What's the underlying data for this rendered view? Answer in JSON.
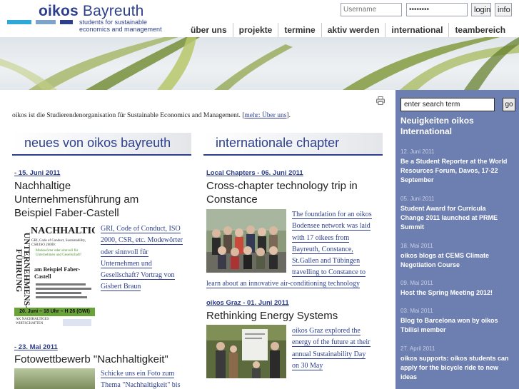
{
  "header": {
    "logo_word_1": "oikos",
    "logo_word_2": "Bayreuth",
    "logo_sub_1": "students for sustainable",
    "logo_sub_2": "economics and management",
    "username_placeholder": "Username",
    "password_value": "••••••••",
    "login_label": "login",
    "info_label": "info",
    "colors": {
      "brand": "#2d3f8c",
      "bar_cyan": "#2fa8d8",
      "bar_blue": "#7ea3c9",
      "bar_dark": "#2d3f8c"
    }
  },
  "nav": [
    {
      "label": "über uns"
    },
    {
      "label": "projekte"
    },
    {
      "label": "termine"
    },
    {
      "label": "aktiv werden"
    },
    {
      "label": "international"
    },
    {
      "label": "teambereich"
    }
  ],
  "intro": {
    "text": "oikos ist die Studierendenorganisation für Sustainable Economics and Management. [",
    "link": "mehr: Über uns",
    "end": "]."
  },
  "sections": {
    "left_heading": "neues von oikos bayreuth",
    "right_heading": "internationale chapter"
  },
  "left_articles": [
    {
      "date": "- 15. Juni 2011",
      "title_1": "Nachhaltige",
      "title_2": "Unternehmensführung am",
      "title_3": "Beispiel Faber-Castell",
      "body": [
        "GRI, Code of Conduct, ISO",
        "2000, CSR, etc. Modewörter",
        "oder sinnvoll für",
        "Unternehmen und",
        "Gesellschaft? Vortrag von",
        "Gisbert Braun"
      ],
      "poster": {
        "vertical_1": "UNTERNEHMENS-",
        "vertical_2": "FÜHRUNG",
        "headline": "NACHHALTIGE",
        "sub": "GRI, Code of Conduct, Sustainability, CSR/ISO 26000:",
        "sub2": "Modewörter oder sinnvoll für Unternehmen und Gesellschaft?",
        "example_1": "am Beispiel Faber-",
        "example_2": "Castell",
        "date_band": "20. Juni – 18 Uhr – H 26 (GWI)",
        "org": "AK NACHHALTIGES WIRTSCHAFTEN"
      }
    },
    {
      "date": "- 23. Mai 2011",
      "title": "Fotowettbewerb \"Nachhaltigkeit\"",
      "body": [
        "Schicke uns ein Foto zum",
        "Thema \"Nachhaltigkeit\" bis"
      ]
    }
  ],
  "right_articles": [
    {
      "date": "Local Chapters - 06. Juni 2011",
      "title_1": "Cross-chapter technology trip in",
      "title_2": "Constance",
      "body": [
        "The foundation for an oikos",
        "Bodensee network was laid",
        "with 17 oikees from",
        "Bayreuth, Constance,",
        "St.Gallen and Tübingen",
        "travelling to Constance to"
      ],
      "body_last": "learn about an innovative air-conditioning technology"
    },
    {
      "date": "oikos Graz - 01. Juni 2011",
      "title": "Rethinking Energy Systems",
      "body": [
        "oikos Graz explored the",
        "energy of the future at their",
        "annual Sustainability Day",
        "on 30 May"
      ]
    }
  ],
  "sidebar": {
    "search_value": "enter search term",
    "search_button": "go",
    "title_1": "Neuigkeiten oikos",
    "title_2": "International",
    "news": [
      {
        "date": "12. Juni 2011",
        "lines": [
          "Be a Student Reporter at the World",
          "Resources Forum, Davos, 17-22",
          "September"
        ]
      },
      {
        "date": "05. Juni 2011",
        "lines": [
          "Student Award for Curricula",
          "Change 2011 launched at PRME",
          "Summit"
        ]
      },
      {
        "date": "18. Mai 2011",
        "lines": [
          "oikos blogs at CEMS Climate",
          "Negotiation Course"
        ]
      },
      {
        "date": "09. Mai 2011",
        "lines": [
          "Host the Spring Meeting 2012!"
        ]
      },
      {
        "date": "03. Mai 2011",
        "lines": [
          "Blog to Barcelona won by oikos",
          "Tbilisi member"
        ]
      },
      {
        "date": "27. April 2011",
        "lines": [
          "oikos supports: oikos students can",
          "apply for the bicycle ride to new",
          "ideas"
        ]
      }
    ]
  }
}
